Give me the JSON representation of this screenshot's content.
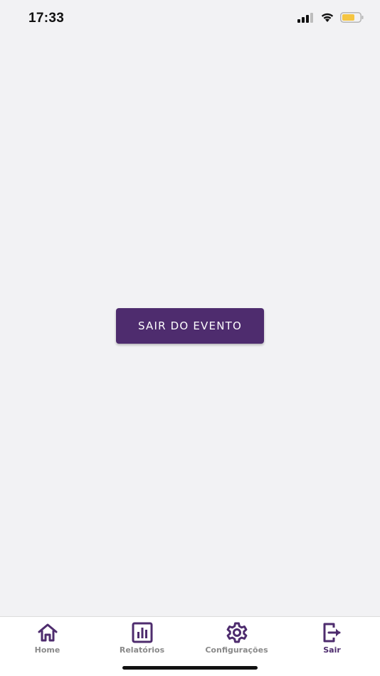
{
  "status_bar": {
    "time": "17:33",
    "signal_icon": "cellular-signal-icon",
    "wifi_icon": "wifi-icon",
    "battery_icon": "battery-icon",
    "battery_color": "#f5c542"
  },
  "main": {
    "exit_event_label": "SAIR DO EVENTO",
    "accent_color": "#4e2c6e"
  },
  "tab_bar": {
    "tabs": [
      {
        "label": "Home",
        "icon": "home-icon",
        "active": false
      },
      {
        "label": "Relatórios",
        "icon": "bar-chart-icon",
        "active": false
      },
      {
        "label": "Configurações",
        "icon": "gear-icon",
        "active": false
      },
      {
        "label": "Sair",
        "icon": "logout-icon",
        "active": true
      }
    ],
    "active_color": "#4e2c6e",
    "inactive_label_color": "#8a8a8a"
  }
}
